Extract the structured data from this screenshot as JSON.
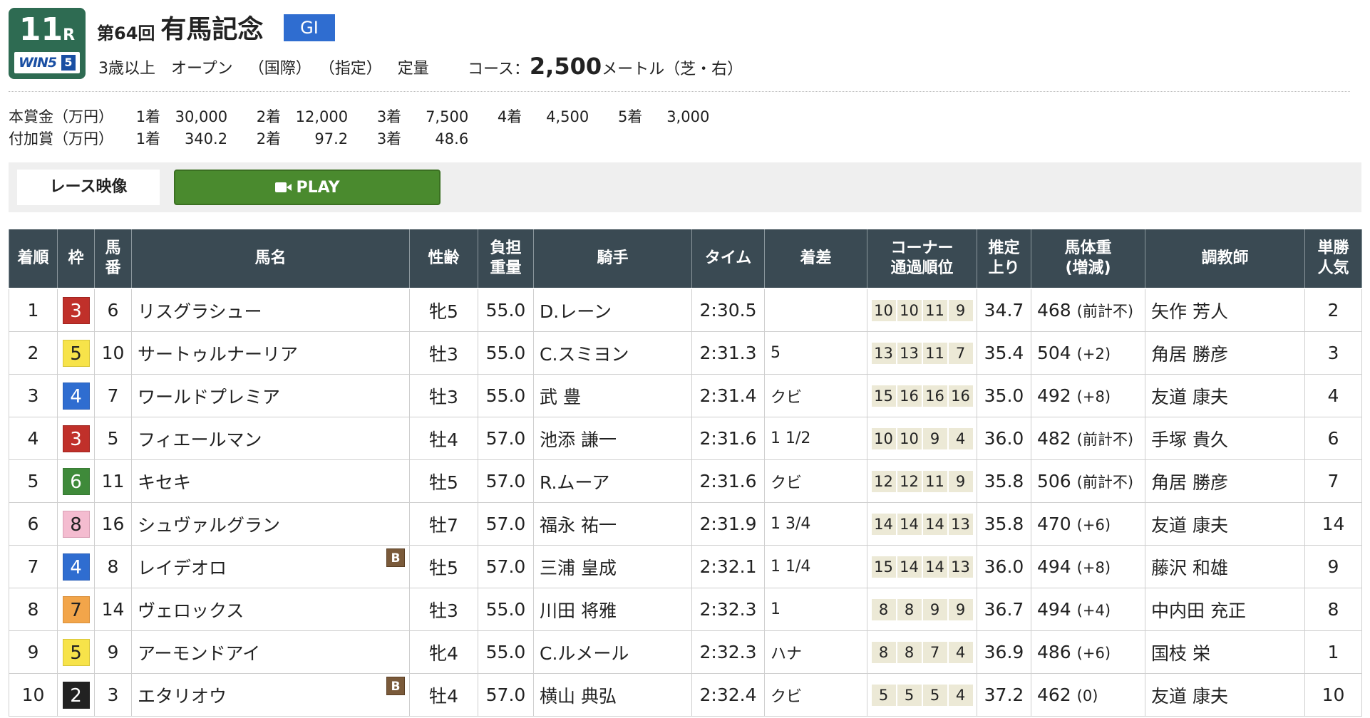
{
  "race": {
    "number": "11",
    "number_suffix": "R",
    "win5_label": "WIN5",
    "win5_num": "5",
    "kai": "第64回",
    "name": "有馬記念",
    "grade": "GI",
    "conditions": [
      "3歳以上",
      "オープン",
      "（国際）",
      "（指定）",
      "定量"
    ],
    "course_label": "コース：",
    "course_distance": "2,500",
    "course_unit": "メートル（芝・右）"
  },
  "prize": {
    "main": {
      "label": "本賞金（万円）",
      "items": [
        {
          "rank": "1着",
          "amount": "30,000"
        },
        {
          "rank": "2着",
          "amount": "12,000"
        },
        {
          "rank": "3着",
          "amount": "7,500"
        },
        {
          "rank": "4着",
          "amount": "4,500"
        },
        {
          "rank": "5着",
          "amount": "3,000"
        }
      ]
    },
    "bonus": {
      "label": "付加賞（万円）",
      "items": [
        {
          "rank": "1着",
          "amount": "340.2"
        },
        {
          "rank": "2着",
          "amount": "97.2"
        },
        {
          "rank": "3着",
          "amount": "48.6"
        }
      ]
    }
  },
  "video": {
    "label": "レース映像",
    "play": "PLAY"
  },
  "table": {
    "headers": {
      "chakujun": "着順",
      "waku": "枠",
      "umaban1": "馬",
      "umaban2": "番",
      "horse": "馬名",
      "seirei": "性齢",
      "futan1": "負担",
      "futan2": "重量",
      "jockey": "騎手",
      "time": "タイム",
      "margin": "着差",
      "corner1": "コーナー",
      "corner2": "通過順位",
      "agari1": "推定",
      "agari2": "上り",
      "weight1": "馬体重",
      "weight2": "(増減)",
      "trainer": "調教師",
      "pop1": "単勝",
      "pop2": "人気"
    },
    "rows": [
      {
        "pos": "1",
        "waku": "3",
        "num": "6",
        "horse": "リスグラシュー",
        "blinker": "",
        "sex_age": "牝5",
        "load": "55.0",
        "jockey": "D.レーン",
        "time": "2:30.5",
        "margin": "",
        "corners": [
          "10",
          "10",
          "11",
          "9"
        ],
        "agari": "34.7",
        "weight": "468",
        "weight_diff": "(前計不)",
        "trainer": "矢作 芳人",
        "pop": "2"
      },
      {
        "pos": "2",
        "waku": "5",
        "num": "10",
        "horse": "サートゥルナーリア",
        "blinker": "",
        "sex_age": "牡3",
        "load": "55.0",
        "jockey": "C.スミヨン",
        "time": "2:31.3",
        "margin": "5",
        "corners": [
          "13",
          "13",
          "11",
          "7"
        ],
        "agari": "35.4",
        "weight": "504",
        "weight_diff": "(+2)",
        "trainer": "角居 勝彦",
        "pop": "3"
      },
      {
        "pos": "3",
        "waku": "4",
        "num": "7",
        "horse": "ワールドプレミア",
        "blinker": "",
        "sex_age": "牡3",
        "load": "55.0",
        "jockey": "武 豊",
        "time": "2:31.4",
        "margin": "クビ",
        "corners": [
          "15",
          "16",
          "16",
          "16"
        ],
        "agari": "35.0",
        "weight": "492",
        "weight_diff": "(+8)",
        "trainer": "友道 康夫",
        "pop": "4"
      },
      {
        "pos": "4",
        "waku": "3",
        "num": "5",
        "horse": "フィエールマン",
        "blinker": "",
        "sex_age": "牡4",
        "load": "57.0",
        "jockey": "池添 謙一",
        "time": "2:31.6",
        "margin": "1 1/2",
        "corners": [
          "10",
          "10",
          "9",
          "4"
        ],
        "agari": "36.0",
        "weight": "482",
        "weight_diff": "(前計不)",
        "trainer": "手塚 貴久",
        "pop": "6"
      },
      {
        "pos": "5",
        "waku": "6",
        "num": "11",
        "horse": "キセキ",
        "blinker": "",
        "sex_age": "牡5",
        "load": "57.0",
        "jockey": "R.ムーア",
        "time": "2:31.6",
        "margin": "クビ",
        "corners": [
          "12",
          "12",
          "11",
          "9"
        ],
        "agari": "35.8",
        "weight": "506",
        "weight_diff": "(前計不)",
        "trainer": "角居 勝彦",
        "pop": "7"
      },
      {
        "pos": "6",
        "waku": "8",
        "num": "16",
        "horse": "シュヴァルグラン",
        "blinker": "",
        "sex_age": "牡7",
        "load": "57.0",
        "jockey": "福永 祐一",
        "time": "2:31.9",
        "margin": "1 3/4",
        "corners": [
          "14",
          "14",
          "14",
          "13"
        ],
        "agari": "35.8",
        "weight": "470",
        "weight_diff": "(+6)",
        "trainer": "友道 康夫",
        "pop": "14"
      },
      {
        "pos": "7",
        "waku": "4",
        "num": "8",
        "horse": "レイデオロ",
        "blinker": "B",
        "sex_age": "牡5",
        "load": "57.0",
        "jockey": "三浦 皇成",
        "time": "2:32.1",
        "margin": "1 1/4",
        "corners": [
          "15",
          "14",
          "14",
          "13"
        ],
        "agari": "36.0",
        "weight": "494",
        "weight_diff": "(+8)",
        "trainer": "藤沢 和雄",
        "pop": "9"
      },
      {
        "pos": "8",
        "waku": "7",
        "num": "14",
        "horse": "ヴェロックス",
        "blinker": "",
        "sex_age": "牡3",
        "load": "55.0",
        "jockey": "川田 将雅",
        "time": "2:32.3",
        "margin": "1",
        "corners": [
          "8",
          "8",
          "9",
          "9"
        ],
        "agari": "36.7",
        "weight": "494",
        "weight_diff": "(+4)",
        "trainer": "中内田 充正",
        "pop": "8"
      },
      {
        "pos": "9",
        "waku": "5",
        "num": "9",
        "horse": "アーモンドアイ",
        "blinker": "",
        "sex_age": "牝4",
        "load": "55.0",
        "jockey": "C.ルメール",
        "time": "2:32.3",
        "margin": "ハナ",
        "corners": [
          "8",
          "8",
          "7",
          "4"
        ],
        "agari": "36.9",
        "weight": "486",
        "weight_diff": "(+6)",
        "trainer": "国枝 栄",
        "pop": "1"
      },
      {
        "pos": "10",
        "waku": "2",
        "num": "3",
        "horse": "エタリオウ",
        "blinker": "B",
        "sex_age": "牡4",
        "load": "57.0",
        "jockey": "横山 典弘",
        "time": "2:32.4",
        "margin": "クビ",
        "corners": [
          "5",
          "5",
          "5",
          "4"
        ],
        "agari": "37.2",
        "weight": "462",
        "weight_diff": "(0)",
        "trainer": "友道 康夫",
        "pop": "10"
      }
    ]
  }
}
